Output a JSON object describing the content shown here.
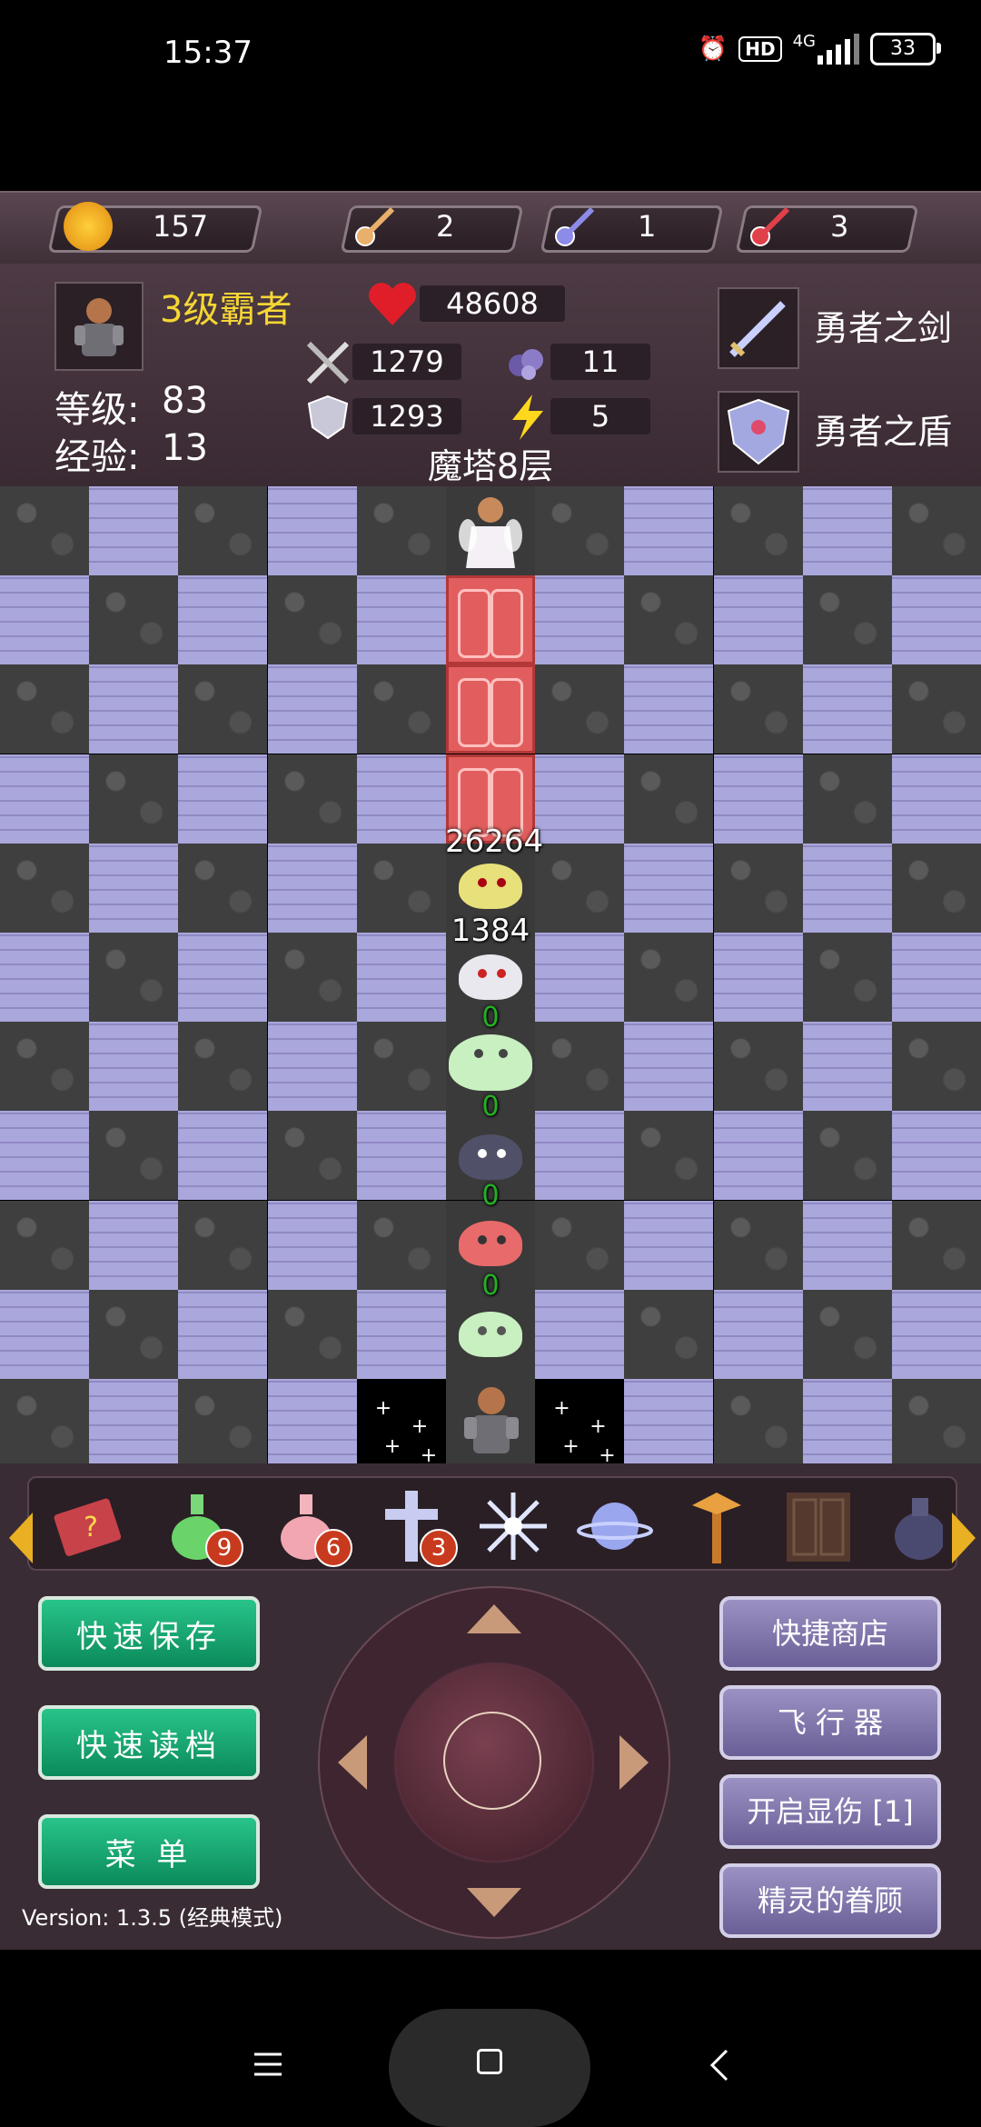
{
  "status_bar": {
    "time": "15:37",
    "hd": "HD",
    "network": "4G",
    "battery": "33"
  },
  "resources": {
    "gold": "157",
    "yellow_keys": "2",
    "blue_keys": "1",
    "red_keys": "3"
  },
  "hero": {
    "title": "3级霸者",
    "level_label": "等级:",
    "level": "83",
    "exp_label": "经验:",
    "exp": "13",
    "hp": "48608",
    "attack": "1279",
    "defense": "1293",
    "magic_defense": "11",
    "agility": "5",
    "weapon": "勇者之剑",
    "shield": "勇者之盾",
    "floor": "魔塔8层"
  },
  "map": {
    "damage_labels": [
      "26264",
      "1384",
      "0",
      "0",
      "0",
      "0"
    ]
  },
  "items": {
    "green_potion_count": "9",
    "pink_potion_count": "6",
    "cross_count": "3"
  },
  "controls": {
    "quick_save": "快速保存",
    "quick_load": "快速读档",
    "menu": "菜 单",
    "quick_shop": "快捷商店",
    "flyer": "飞 行 器",
    "show_damage": "开启显伤 [1]",
    "fairy_favor": "精灵的眷顾",
    "version": "Version: 1.3.5 (经典模式)"
  },
  "colors": {
    "accent_gold": "#f5d634",
    "button_green": "#18a874",
    "button_purple": "#8579b0"
  }
}
